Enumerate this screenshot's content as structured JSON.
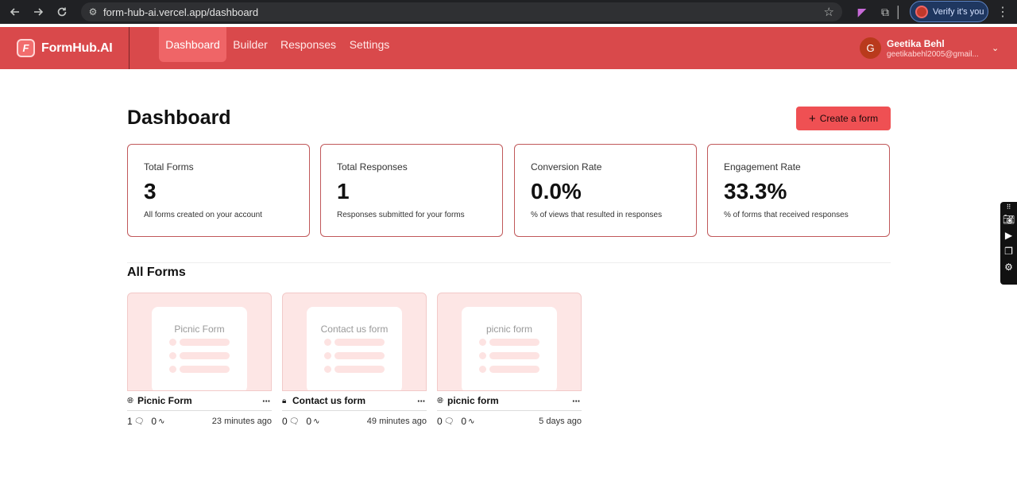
{
  "browser": {
    "url": "form-hub-ai.vercel.app/dashboard",
    "profile_button": "Verify it's you"
  },
  "app": {
    "brand": "FormHub.AI",
    "logo_letter": "F",
    "tabs": [
      {
        "label": "Dashboard",
        "active": true
      },
      {
        "label": "Builder",
        "active": false
      },
      {
        "label": "Responses",
        "active": false
      },
      {
        "label": "Settings",
        "active": false
      }
    ],
    "user": {
      "initial": "G",
      "name": "Geetika Behl",
      "email": "geetikabehl2005@gmail..."
    },
    "accent_color": "#d9494b"
  },
  "dashboard": {
    "title": "Dashboard",
    "create_button": "Create a form",
    "stats": [
      {
        "label": "Total Forms",
        "value": "3",
        "desc": "All forms created on your account"
      },
      {
        "label": "Total Responses",
        "value": "1",
        "desc": "Responses submitted for your forms"
      },
      {
        "label": "Conversion Rate",
        "value": "0.0%",
        "desc": "% of views that resulted in responses"
      },
      {
        "label": "Engagement Rate",
        "value": "33.3%",
        "desc": "% of forms that received responses"
      }
    ],
    "forms_title": "All Forms",
    "forms": [
      {
        "preview_title": "Picnic Form",
        "name": "Picnic Form",
        "visibility_icon": "globe-icon",
        "responses": "1",
        "views": "0",
        "time": "23 minutes ago"
      },
      {
        "preview_title": "Contact us form",
        "name": "Contact us form",
        "visibility_icon": "lock-icon",
        "responses": "0",
        "views": "0",
        "time": "49 minutes ago"
      },
      {
        "preview_title": "picnic form",
        "name": "picnic form",
        "visibility_icon": "globe-icon",
        "responses": "0",
        "views": "0",
        "time": "5 days ago"
      }
    ]
  }
}
